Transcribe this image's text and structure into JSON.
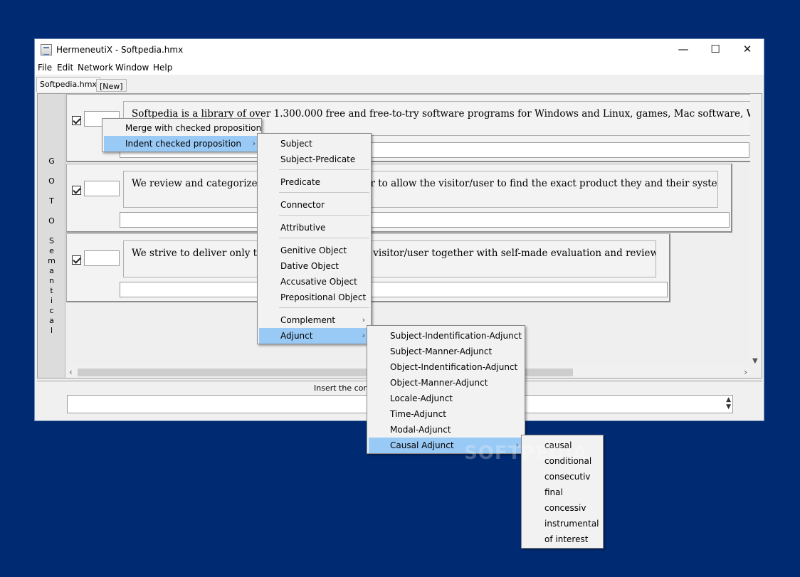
{
  "window": {
    "title": "HermeneutiX - Softpedia.hmx",
    "controls": {
      "minimize": "—",
      "maximize": "☐",
      "close": "✕"
    }
  },
  "menubar": [
    "File",
    "Edit",
    "Network",
    "Window",
    "Help"
  ],
  "tabs": {
    "active": "Softpedia.hmx",
    "new": "[New]"
  },
  "sidebar": {
    "text": "G\n\nO\n\nT\n\nO\n\nS\ne\nm\na\nn\nt\ni\nc\na\nl"
  },
  "propositions": [
    {
      "checked": true,
      "text": "Softpedia is a library of over 1.300.000 free and free-to-try software programs for Windows and Linux, games, Mac software, Windows drivers"
    },
    {
      "checked": true,
      "text": "We review and categorize these products in order to allow the visitor/user to find the exact product they and their system needs."
    },
    {
      "checked": true,
      "text": "We strive to deliver only the best products to the visitor/user together with self-made evaluation and review notes."
    }
  ],
  "bottom": {
    "insert_label": "Insert the comment"
  },
  "context_menu": {
    "items": [
      "Merge with checked proposition",
      "Indent checked proposition"
    ],
    "selected": "Indent checked proposition"
  },
  "submenu_roles": {
    "items": [
      "Subject",
      "Subject-Predicate",
      "Predicate",
      "Connector",
      "Attributive",
      "Genitive Object",
      "Dative Object",
      "Accusative Object",
      "Prepositional Object",
      "Complement",
      "Adjunct"
    ],
    "selected": "Adjunct"
  },
  "submenu_adjunct": {
    "items": [
      "Subject-Indentification-Adjunct",
      "Subject-Manner-Adjunct",
      "Object-Indentification-Adjunct",
      "Object-Manner-Adjunct",
      "Locale-Adjunct",
      "Time-Adjunct",
      "Modal-Adjunct",
      "Causal Adjunct"
    ],
    "selected": "Causal Adjunct"
  },
  "submenu_causal": {
    "items": [
      "causal",
      "conditional",
      "consecutiv",
      "final",
      "concessiv",
      "instrumental",
      "of interest"
    ]
  },
  "watermark": "SOFTPEDIA",
  "colors": {
    "desktop": "#002b73",
    "menu_highlight": "#99c9f5",
    "window_bg": "#f0f0f0"
  }
}
